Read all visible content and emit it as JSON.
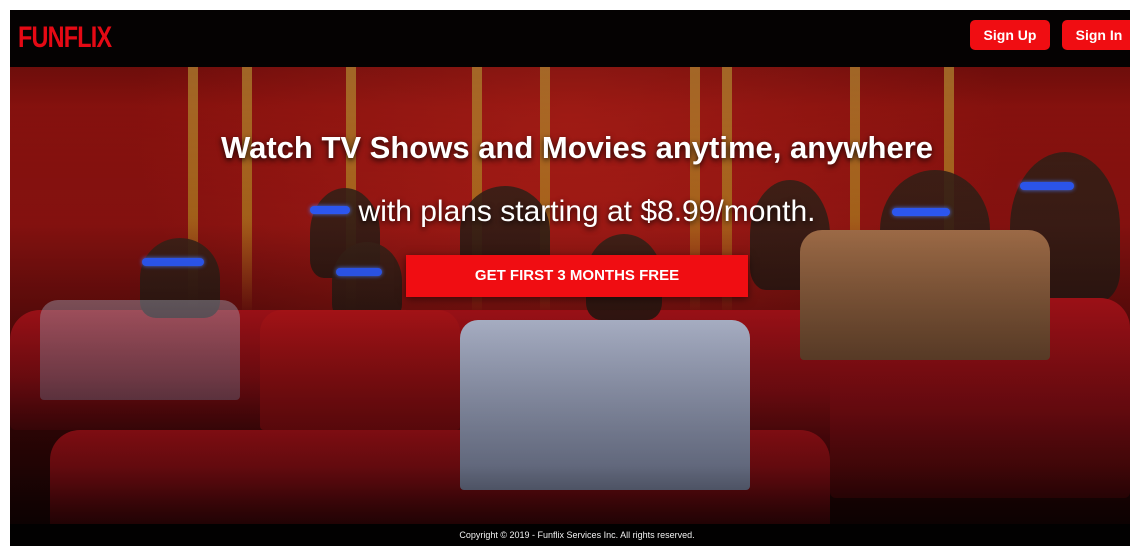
{
  "header": {
    "logo_text": "FUNFLIX",
    "signup_label": "Sign Up",
    "signin_label": "Sign In"
  },
  "hero": {
    "headline": "Watch TV Shows and Movies anytime, anywhere",
    "subline": "with plans starting at $8.99/month.",
    "cta_label": "GET FIRST 3 MONTHS FREE",
    "background_icon": "movie-theater-audience-3d-glasses-image"
  },
  "footer": {
    "copyright": "Copyright © 2019 - Funflix Services Inc. All rights reserved."
  },
  "colors": {
    "brand_red": "#e50914",
    "button_red": "#f00d12",
    "header_bg": "#050202",
    "text_white": "#ffffff"
  }
}
